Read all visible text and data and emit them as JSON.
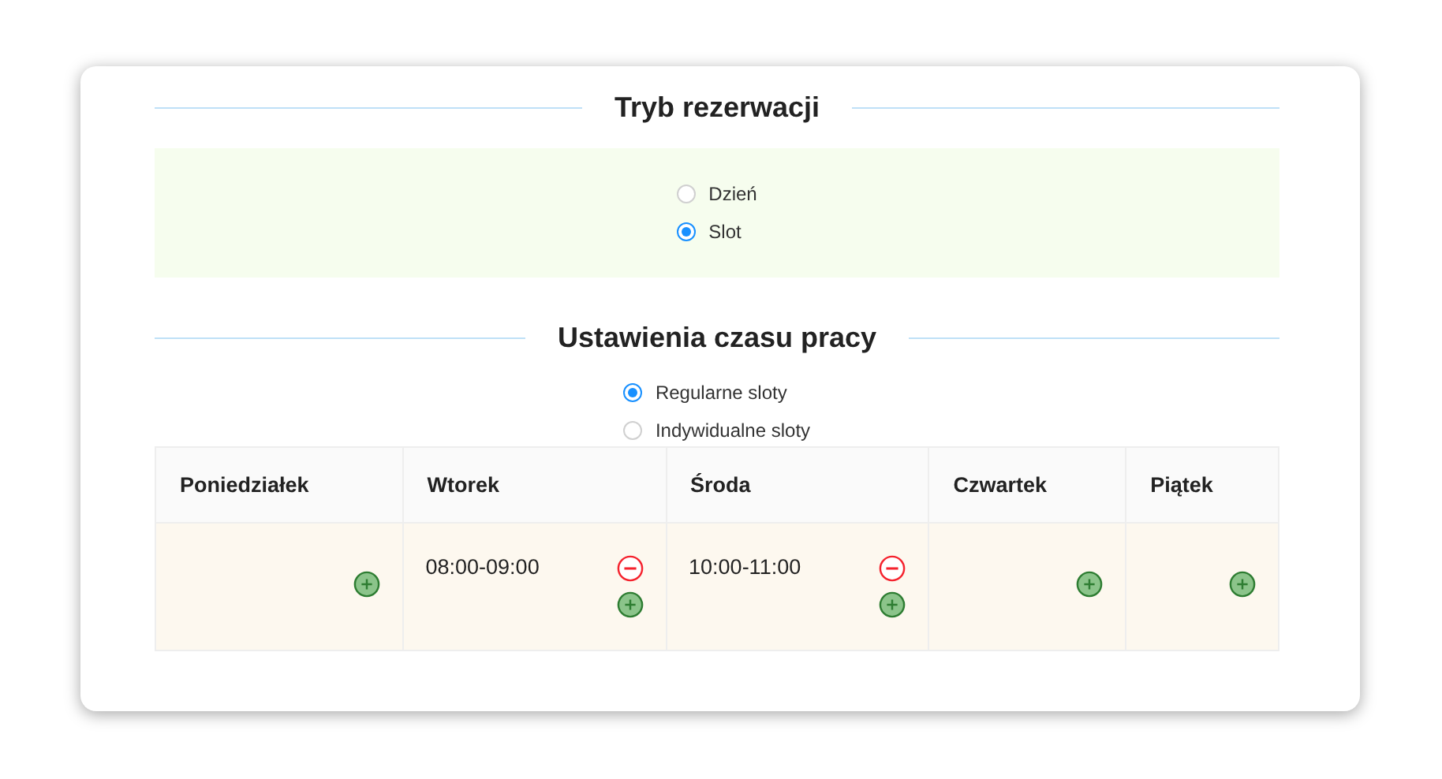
{
  "sections": [
    {
      "title": "Tryb rezerwacji",
      "highlighted": true,
      "options": [
        {
          "label": "Dzień",
          "selected": false
        },
        {
          "label": "Slot",
          "selected": true
        }
      ]
    },
    {
      "title": "Ustawienia czasu pracy",
      "highlighted": false,
      "options": [
        {
          "label": "Regularne sloty",
          "selected": true
        },
        {
          "label": "Indywidualne sloty",
          "selected": false
        }
      ]
    }
  ],
  "schedule": {
    "days": [
      {
        "name": "Poniedziałek"
      },
      {
        "name": "Wtorek",
        "slots": [
          "08:00-09:00"
        ]
      },
      {
        "name": "Środa",
        "slots": [
          "10:00-11:00"
        ]
      },
      {
        "name": "Czwartek"
      },
      {
        "name": "Piątek"
      }
    ]
  }
}
